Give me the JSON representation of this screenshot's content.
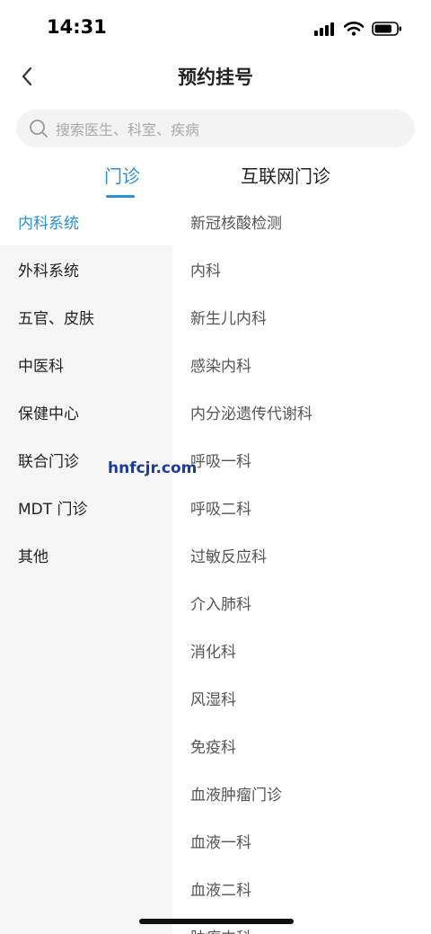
{
  "status_bar": {
    "time": "14:31",
    "battery_level": 0.8
  },
  "nav": {
    "title": "预约挂号",
    "back_icon": "chevron-left-icon"
  },
  "search": {
    "placeholder": "搜索医生、科室、疾病",
    "icon": "search-icon"
  },
  "tabs": [
    {
      "label": "门诊",
      "active": true
    },
    {
      "label": "互联网门诊",
      "active": false
    }
  ],
  "categories": [
    {
      "label": "内科系统",
      "active": true
    },
    {
      "label": "外科系统",
      "active": false
    },
    {
      "label": "五官、皮肤",
      "active": false
    },
    {
      "label": "中医科",
      "active": false
    },
    {
      "label": "保健中心",
      "active": false
    },
    {
      "label": "联合门诊",
      "active": false
    },
    {
      "label": "MDT 门诊",
      "active": false
    },
    {
      "label": "其他",
      "active": false
    }
  ],
  "departments": [
    "新冠核酸检测",
    "内科",
    "新生儿内科",
    "感染内科",
    "内分泌遗传代谢科",
    "呼吸一科",
    "呼吸二科",
    "过敏反应科",
    "介入肺科",
    "消化科",
    "风湿科",
    "免疫科",
    "血液肿瘤门诊",
    "血液一科",
    "血液二科",
    "肿瘤内科"
  ],
  "watermark": "hnfcjr.com",
  "colors": {
    "accent": "#2d8fd4",
    "sidebar_bg": "#f5f5f5",
    "search_bg": "#f3f3f3"
  }
}
